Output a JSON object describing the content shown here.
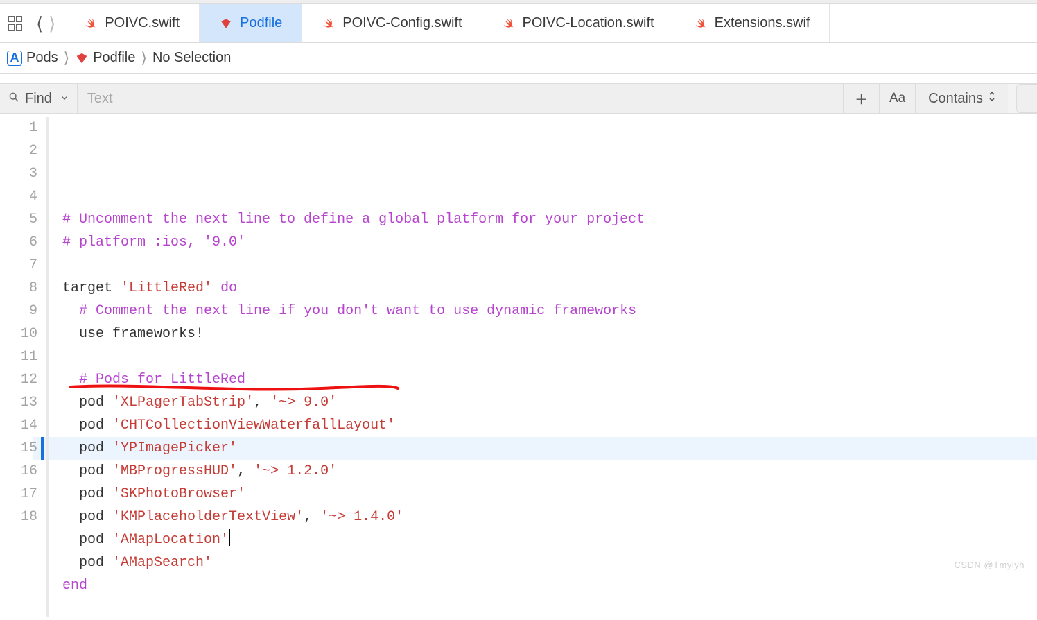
{
  "tabs": [
    {
      "label": "POIVC.swift",
      "type": "swift",
      "active": false
    },
    {
      "label": "Podfile",
      "type": "ruby",
      "active": true
    },
    {
      "label": "POIVC-Config.swift",
      "type": "swift",
      "active": false
    },
    {
      "label": "POIVC-Location.swift",
      "type": "swift",
      "active": false
    },
    {
      "label": "Extensions.swif",
      "type": "swift",
      "active": false
    }
  ],
  "breadcrumb": {
    "root": "Pods",
    "file": "Podfile",
    "selection": "No Selection"
  },
  "findbar": {
    "mode_label": "Find",
    "placeholder": "Text",
    "case_label": "Aa",
    "match_mode": "Contains"
  },
  "code": {
    "lines": [
      {
        "n": 1,
        "segs": [
          {
            "cls": "c-comment",
            "t": "# Uncomment the next line to define a global platform for your project"
          }
        ]
      },
      {
        "n": 2,
        "segs": [
          {
            "cls": "c-comment",
            "t": "# platform :ios, '9.0'"
          }
        ]
      },
      {
        "n": 3,
        "segs": []
      },
      {
        "n": 4,
        "segs": [
          {
            "cls": "c-ident",
            "t": "target "
          },
          {
            "cls": "c-string",
            "t": "'LittleRed'"
          },
          {
            "cls": "c-ident",
            "t": " "
          },
          {
            "cls": "c-keyword",
            "t": "do"
          }
        ]
      },
      {
        "n": 5,
        "indent": 1,
        "segs": [
          {
            "cls": "c-comment",
            "t": "# Comment the next line if you don't want to use dynamic frameworks"
          }
        ]
      },
      {
        "n": 6,
        "indent": 1,
        "segs": [
          {
            "cls": "c-ident",
            "t": "use_frameworks!"
          }
        ]
      },
      {
        "n": 7,
        "segs": []
      },
      {
        "n": 8,
        "indent": 1,
        "segs": [
          {
            "cls": "c-comment",
            "t": "# Pods for LittleRed"
          }
        ]
      },
      {
        "n": 9,
        "indent": 1,
        "segs": [
          {
            "cls": "c-ident",
            "t": "pod "
          },
          {
            "cls": "c-string",
            "t": "'XLPagerTabStrip'"
          },
          {
            "cls": "c-ident",
            "t": ", "
          },
          {
            "cls": "c-string",
            "t": "'~> 9.0'"
          }
        ]
      },
      {
        "n": 10,
        "indent": 1,
        "segs": [
          {
            "cls": "c-ident",
            "t": "pod "
          },
          {
            "cls": "c-string",
            "t": "'CHTCollectionViewWaterfallLayout'"
          }
        ]
      },
      {
        "n": 11,
        "indent": 1,
        "segs": [
          {
            "cls": "c-ident",
            "t": "pod "
          },
          {
            "cls": "c-string",
            "t": "'YPImagePicker'"
          }
        ]
      },
      {
        "n": 12,
        "indent": 1,
        "segs": [
          {
            "cls": "c-ident",
            "t": "pod "
          },
          {
            "cls": "c-string",
            "t": "'MBProgressHUD'"
          },
          {
            "cls": "c-ident",
            "t": ", "
          },
          {
            "cls": "c-string",
            "t": "'~> 1.2.0'"
          }
        ],
        "annotated": true
      },
      {
        "n": 13,
        "indent": 1,
        "segs": [
          {
            "cls": "c-ident",
            "t": "pod "
          },
          {
            "cls": "c-string",
            "t": "'SKPhotoBrowser'"
          }
        ]
      },
      {
        "n": 14,
        "indent": 1,
        "segs": [
          {
            "cls": "c-ident",
            "t": "pod "
          },
          {
            "cls": "c-string",
            "t": "'KMPlaceholderTextView'"
          },
          {
            "cls": "c-ident",
            "t": ", "
          },
          {
            "cls": "c-string",
            "t": "'~> 1.4.0'"
          }
        ]
      },
      {
        "n": 15,
        "indent": 1,
        "segs": [
          {
            "cls": "c-ident",
            "t": "pod "
          },
          {
            "cls": "c-string",
            "t": "'AMapLocation'"
          }
        ],
        "cursor_after": true,
        "current": true
      },
      {
        "n": 16,
        "indent": 1,
        "segs": [
          {
            "cls": "c-ident",
            "t": "pod "
          },
          {
            "cls": "c-string",
            "t": "'AMapSearch'"
          }
        ]
      },
      {
        "n": 17,
        "segs": [
          {
            "cls": "c-keyword",
            "t": "end"
          }
        ]
      },
      {
        "n": 18,
        "segs": []
      }
    ]
  },
  "watermark": "CSDN @Tmylyh"
}
